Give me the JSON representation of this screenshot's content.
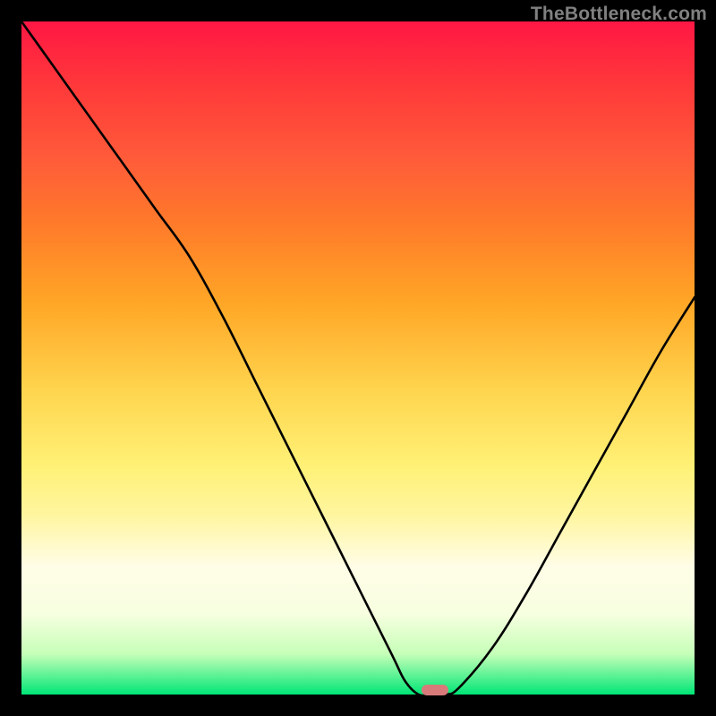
{
  "watermark": "TheBottleneck.com",
  "marker": {
    "x_pct": 61.5,
    "y_pct": 99.3,
    "color": "#d97a7a"
  },
  "chart_data": {
    "type": "line",
    "title": "",
    "xlabel": "",
    "ylabel": "",
    "xlim": [
      0,
      100
    ],
    "ylim": [
      0,
      100
    ],
    "grid": false,
    "legend": false,
    "series": [
      {
        "name": "bottleneck-curve",
        "x": [
          0,
          5,
          10,
          15,
          20,
          25,
          30,
          35,
          40,
          45,
          50,
          55,
          57,
          59,
          61,
          63,
          65,
          70,
          75,
          80,
          85,
          90,
          95,
          100
        ],
        "y": [
          100,
          93,
          86,
          79,
          72,
          65,
          56,
          46,
          36,
          26,
          16,
          6,
          2,
          0,
          0,
          0,
          1,
          7,
          15,
          24,
          33,
          42,
          51,
          59
        ]
      }
    ],
    "annotations": [
      {
        "type": "marker",
        "x": 61.5,
        "y": 0.7,
        "shape": "pill",
        "color": "#d97a7a"
      }
    ],
    "background_gradient": {
      "direction": "vertical",
      "stops": [
        {
          "pct": 0,
          "color": "#ff1744"
        },
        {
          "pct": 20,
          "color": "#ff5a3a"
        },
        {
          "pct": 42,
          "color": "#ffa726"
        },
        {
          "pct": 66,
          "color": "#fff176"
        },
        {
          "pct": 88,
          "color": "#f7ffe0"
        },
        {
          "pct": 100,
          "color": "#00e676"
        }
      ]
    }
  }
}
